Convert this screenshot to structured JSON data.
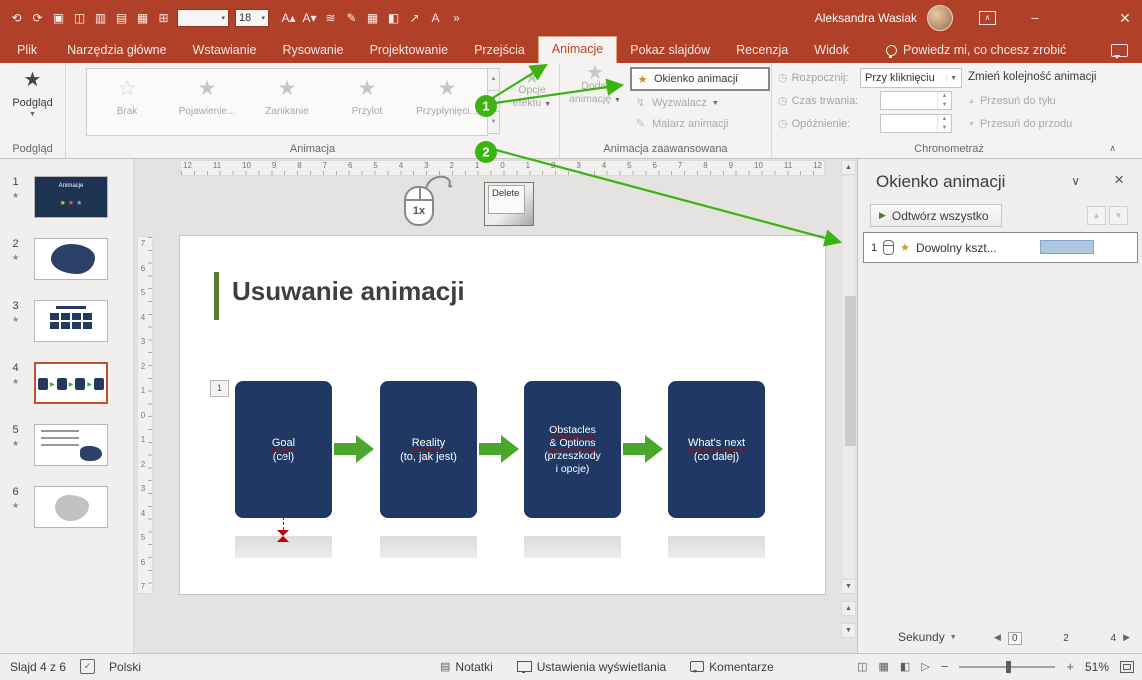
{
  "accent": {
    "titlebar": "#B04028",
    "annotation_green": "#3CB314",
    "shape_navy": "#1F3864",
    "arrow_green": "#4CA52C"
  },
  "titlebar": {
    "qat_icons": [
      "⟲",
      "⟳",
      "▣",
      "◫",
      "▥",
      "▤",
      "▦",
      "⊞"
    ],
    "font_size_value": "18",
    "qat_icons2": [
      "A▴",
      "A▾",
      "≋",
      "✎",
      "▦",
      "◧",
      "↗",
      "A",
      "»"
    ],
    "user_name": "Aleksandra Wasiak"
  },
  "tabs": {
    "items": [
      {
        "label": "Plik"
      },
      {
        "label": "Narzędzia główne"
      },
      {
        "label": "Wstawianie"
      },
      {
        "label": "Rysowanie"
      },
      {
        "label": "Projektowanie"
      },
      {
        "label": "Przejścia"
      },
      {
        "label": "Animacje"
      },
      {
        "label": "Pokaz slajdów"
      },
      {
        "label": "Recenzja"
      },
      {
        "label": "Widok"
      }
    ],
    "tell_me": "Powiedz mi, co chcesz zrobić"
  },
  "ribbon": {
    "preview": {
      "button": "Podgląd",
      "group": "Podgląd"
    },
    "animation": {
      "gallery": [
        "Brak",
        "Pojawienie...",
        "Zanikanie",
        "Przylot",
        "Przypłynięci..."
      ],
      "effect_options": "Opcje efektu",
      "group": "Animacja"
    },
    "advanced": {
      "add_animation": "Dodaj animację",
      "animation_pane": "Okienko animacji",
      "trigger": "Wyzwalacz",
      "painter": "Malarz animacji",
      "group": "Animacja zaawansowana"
    },
    "timing": {
      "start_label": "Rozpocznij:",
      "start_value": "Przy kliknięciu",
      "duration_label": "Czas trwania:",
      "delay_label": "Opóźnienie:",
      "reorder_header": "Zmień kolejność animacji",
      "move_earlier": "Przesuń do tyłu",
      "move_later": "Przesuń do przodu",
      "group": "Chronometraż"
    }
  },
  "annotations": {
    "badge1": "1",
    "badge2": "2"
  },
  "slides": [
    {
      "num": "1",
      "caption": "Animacje"
    },
    {
      "num": "2"
    },
    {
      "num": "3"
    },
    {
      "num": "4"
    },
    {
      "num": "5"
    },
    {
      "num": "6"
    }
  ],
  "rulers": {
    "h_numbers": [
      "12",
      "11",
      "10",
      "9",
      "8",
      "7",
      "6",
      "5",
      "4",
      "3",
      "2",
      "1",
      "0",
      "1",
      "2",
      "3",
      "4",
      "5",
      "6",
      "7",
      "8",
      "9",
      "10",
      "11",
      "12"
    ],
    "v_numbers": [
      "7",
      "6",
      "5",
      "4",
      "3",
      "2",
      "1",
      "0",
      "1",
      "2",
      "3",
      "4",
      "5",
      "6",
      "7"
    ]
  },
  "slide": {
    "title": "Usuwanie animacji",
    "seq_badge": "1",
    "mouse_label": "1x",
    "delete_key": "Delete",
    "shapes": [
      {
        "l1": "Goal",
        "l2": "(cel)"
      },
      {
        "l1": "Reality",
        "l2": "(to, jak jest)"
      },
      {
        "l1": "Obstacles",
        "l2": "& Options",
        "l3": "(przeszkody",
        "l4": "i opcje)"
      },
      {
        "l1": "What's next",
        "l2": "(co dalej)"
      }
    ]
  },
  "animation_pane": {
    "title": "Okienko animacji",
    "play_all": "Odtwórz wszystko",
    "item": {
      "num": "1",
      "name": "Dowolny kszt..."
    },
    "seconds_label": "Sekundy",
    "timeline_numbers": [
      "0",
      "2",
      "4"
    ]
  },
  "statusbar": {
    "slide_info": "Slajd 4 z 6",
    "language": "Polski",
    "notes": "Notatki",
    "display_settings": "Ustawienia wyświetlania",
    "comments": "Komentarze",
    "zoom_level": "51%"
  }
}
